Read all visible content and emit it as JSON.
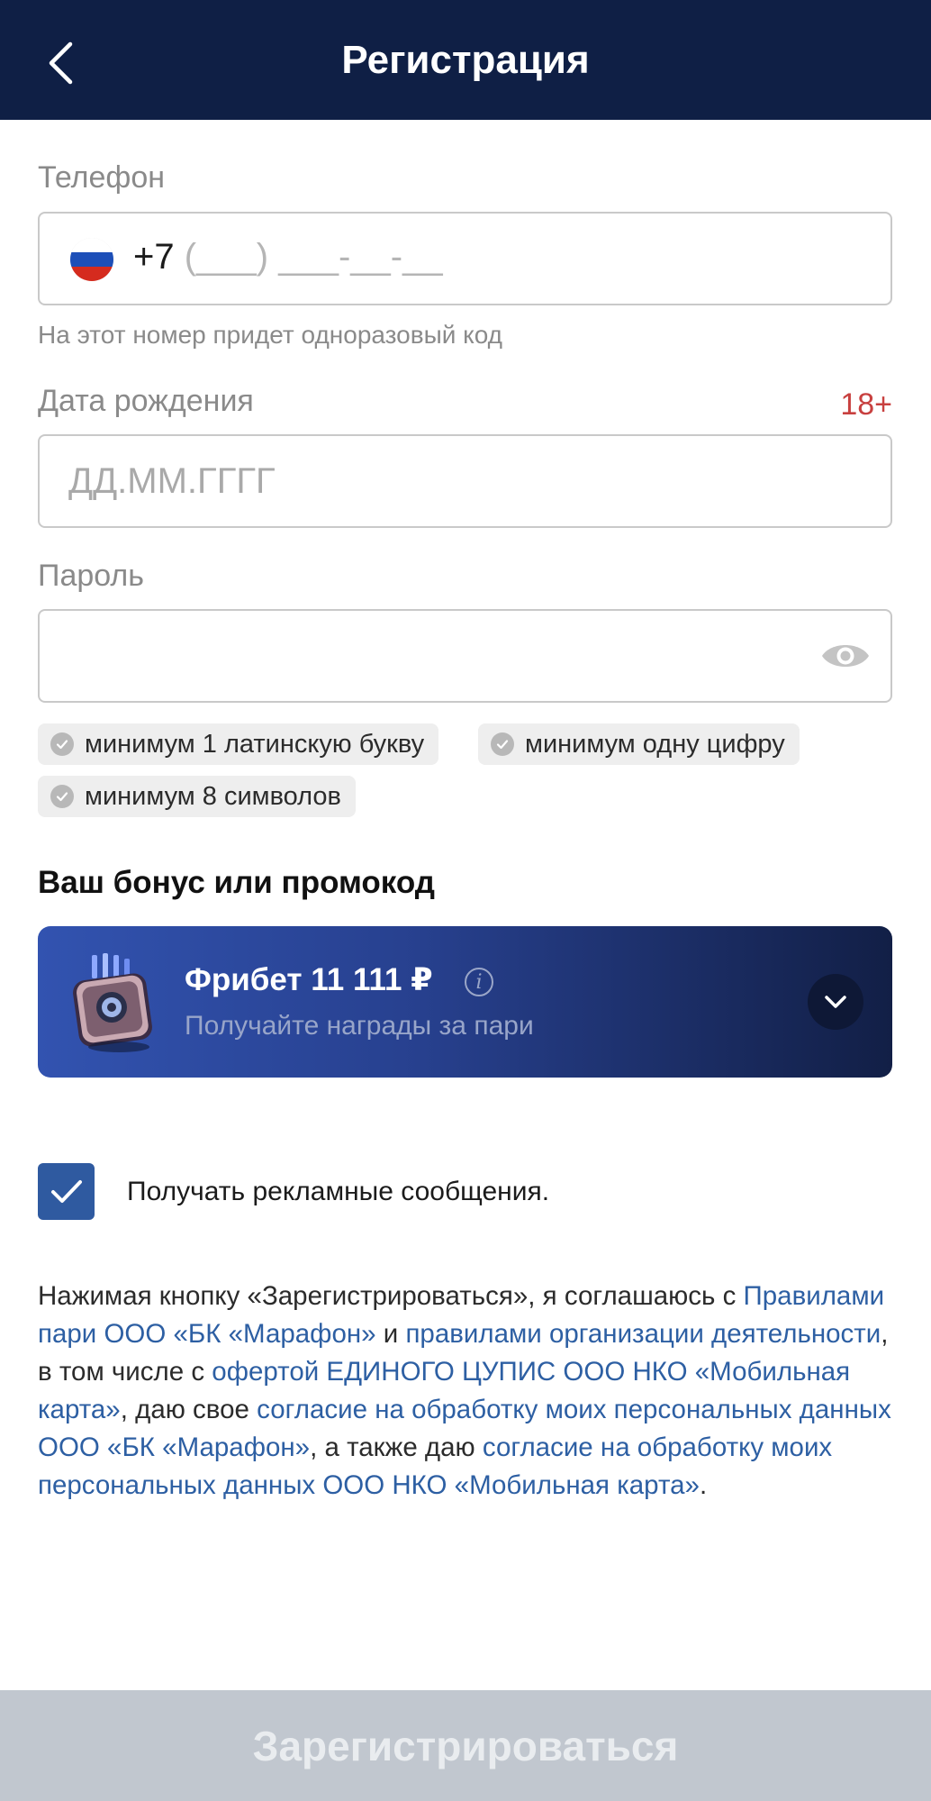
{
  "header": {
    "title": "Регистрация"
  },
  "phone": {
    "label": "Телефон",
    "prefix": "+7",
    "mask": " (___) ___-__-__",
    "hint": "На этот номер придет одноразовый код"
  },
  "birthdate": {
    "label": "Дата рождения",
    "age_badge": "18+",
    "placeholder": "ДД.ММ.ГГГГ"
  },
  "password": {
    "label": "Пароль",
    "requirements": [
      "минимум 1 латинскую букву",
      "минимум одну цифру",
      "минимум 8 символов"
    ]
  },
  "bonus": {
    "section_title": "Ваш бонус или промокод",
    "title": "Фрибет 11 111 ₽",
    "subtitle": "Получайте награды за пари"
  },
  "ads_consent": {
    "label": "Получать рекламные сообщения.",
    "checked": true
  },
  "legal": {
    "t1": "Нажимая кнопку «Зарегистрироваться», я соглашаюсь с ",
    "l1": "Правилами пари ООО «БК «Марафон»",
    "t2": " и ",
    "l2": "правилами организации деятельности",
    "t3": ", в том числе с ",
    "l3": "офертой ЕДИНОГО ЦУПИС ООО НКО «Мобильная карта»",
    "t4": ", даю свое ",
    "l4": "согласие на обработку моих персональных данных ООО «БК «Марафон»",
    "t5": ", а также даю ",
    "l5": "согласие на обработку моих персональных данных ООО НКО «Мобильная карта»",
    "t6": "."
  },
  "submit": {
    "label": "Зарегистрироваться"
  },
  "colors": {
    "header_bg": "#0f1f45",
    "link": "#2d5fa3",
    "age_badge": "#c8403f",
    "checkbox": "#2f5aa0",
    "submit_disabled": "#c1c7cf"
  }
}
